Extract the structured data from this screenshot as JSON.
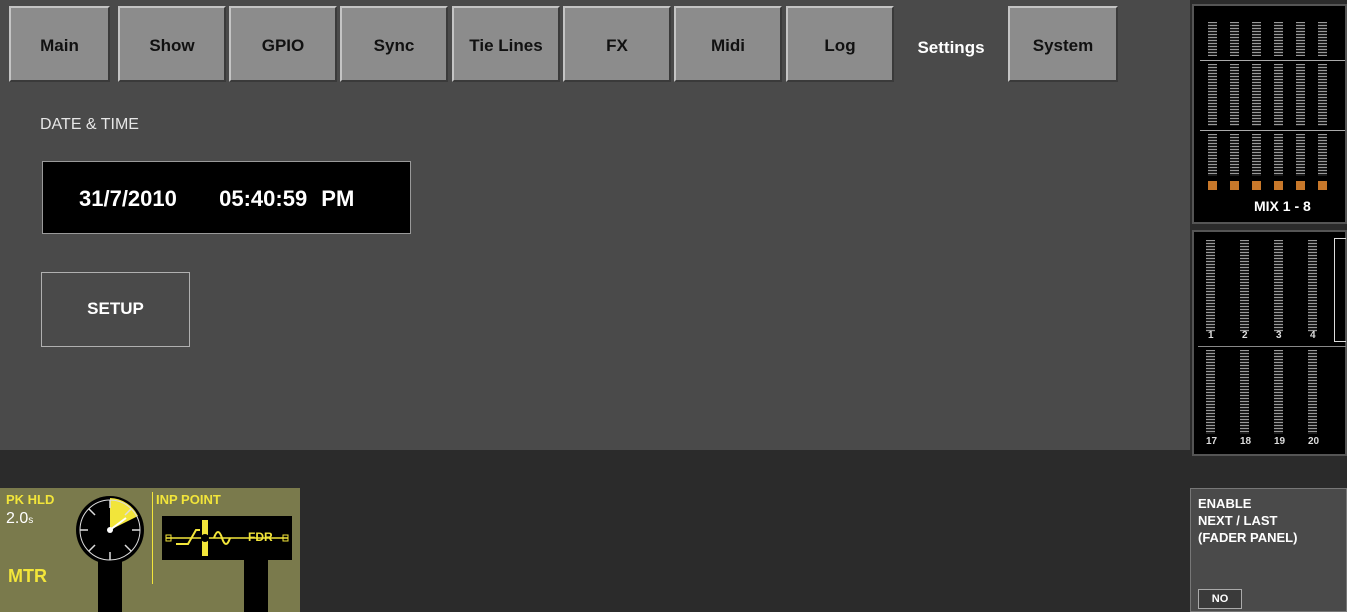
{
  "tabs": [
    {
      "label": "Main"
    },
    {
      "label": "Show"
    },
    {
      "label": "GPIO"
    },
    {
      "label": "Sync"
    },
    {
      "label": "Tie Lines"
    },
    {
      "label": "FX"
    },
    {
      "label": "Midi"
    },
    {
      "label": "Log"
    },
    {
      "label": "Settings",
      "active": true
    },
    {
      "label": "System"
    }
  ],
  "settings": {
    "date_time_label": "DATE & TIME",
    "date": "31/7/2010",
    "time": "05:40:59 PM",
    "setup_label": "SETUP"
  },
  "controls": {
    "pk_hld_label": "PK HLD",
    "pk_hld_value": "2.0",
    "pk_hld_unit": "s",
    "mtr_label": "MTR",
    "inp_point_label": "INP POINT",
    "fdr_label": "FDR"
  },
  "meters": {
    "mix_label": "MIX 1 - 8",
    "channels_top": [
      "1",
      "2",
      "3",
      "4"
    ],
    "channels_bottom": [
      "17",
      "18",
      "19",
      "20"
    ]
  },
  "enable_panel": {
    "title_line1": "ENABLE",
    "title_line2": "NEXT / LAST",
    "title_line3": "(FADER PANEL)",
    "value": "NO"
  },
  "colors": {
    "panel_bg": "#4a4a4a",
    "tab_bg": "#8c8c8c",
    "accent_yellow": "#f2e53a",
    "control_bg": "#7a7a4c",
    "meter_led_orange": "#c8782a"
  }
}
